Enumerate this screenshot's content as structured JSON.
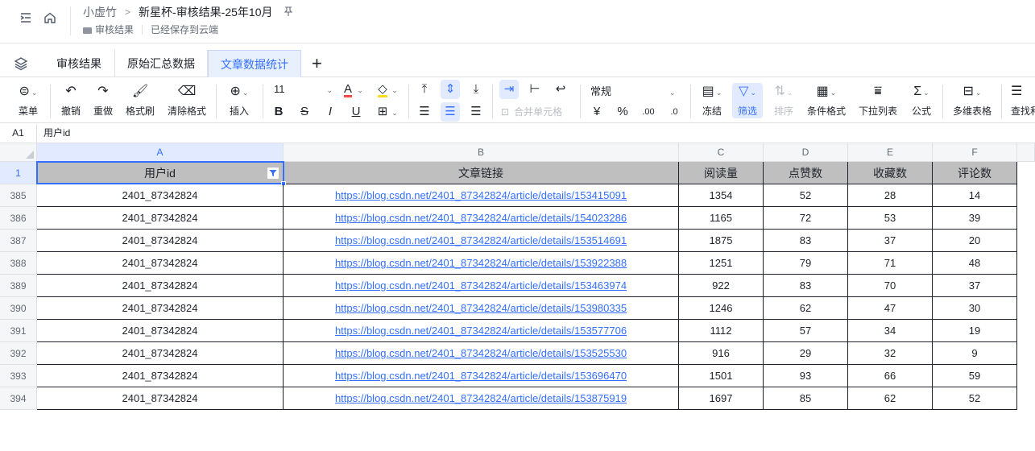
{
  "header": {
    "breadcrumb_parent": "小虚竹",
    "doc_title": "新星杯-审核结果-25年10月",
    "folder": "审核结果",
    "save_status": "已经保存到云端"
  },
  "tabs": [
    "审核结果",
    "原始汇总数据",
    "文章数据统计"
  ],
  "toolbar": {
    "menu": "菜单",
    "undo": "撤销",
    "redo": "重做",
    "format_painter": "格式刷",
    "clear_format": "清除格式",
    "insert": "插入",
    "font_size": "11",
    "merge_cells": "合并单元格",
    "number_format": "常规",
    "currency": "¥",
    "percent": "%",
    "freeze": "冻结",
    "filter": "筛选",
    "sort": "排序",
    "conditional_format": "条件格式",
    "dropdown_list": "下拉列表",
    "formula": "公式",
    "pivot": "多维表格",
    "find": "查找和"
  },
  "formula_bar": {
    "cell_ref": "A1",
    "value": "用户id"
  },
  "grid": {
    "columns": [
      "A",
      "B",
      "C",
      "D",
      "E",
      "F"
    ],
    "header_row_num": "1",
    "headers": [
      "用户id",
      "文章链接",
      "阅读量",
      "点赞数",
      "收藏数",
      "评论数"
    ],
    "rows": [
      {
        "n": "385",
        "user": "2401_87342824",
        "link": "https://blog.csdn.net/2401_87342824/article/details/153415091",
        "read": "1354",
        "like": "52",
        "fav": "28",
        "comment": "14"
      },
      {
        "n": "386",
        "user": "2401_87342824",
        "link": "https://blog.csdn.net/2401_87342824/article/details/154023286",
        "read": "1165",
        "like": "72",
        "fav": "53",
        "comment": "39"
      },
      {
        "n": "387",
        "user": "2401_87342824",
        "link": "https://blog.csdn.net/2401_87342824/article/details/153514691",
        "read": "1875",
        "like": "83",
        "fav": "37",
        "comment": "20"
      },
      {
        "n": "388",
        "user": "2401_87342824",
        "link": "https://blog.csdn.net/2401_87342824/article/details/153922388",
        "read": "1251",
        "like": "79",
        "fav": "71",
        "comment": "48"
      },
      {
        "n": "389",
        "user": "2401_87342824",
        "link": "https://blog.csdn.net/2401_87342824/article/details/153463974",
        "read": "922",
        "like": "83",
        "fav": "70",
        "comment": "37"
      },
      {
        "n": "390",
        "user": "2401_87342824",
        "link": "https://blog.csdn.net/2401_87342824/article/details/153980335",
        "read": "1246",
        "like": "62",
        "fav": "47",
        "comment": "30"
      },
      {
        "n": "391",
        "user": "2401_87342824",
        "link": "https://blog.csdn.net/2401_87342824/article/details/153577706",
        "read": "1112",
        "like": "57",
        "fav": "34",
        "comment": "19"
      },
      {
        "n": "392",
        "user": "2401_87342824",
        "link": "https://blog.csdn.net/2401_87342824/article/details/153525530",
        "read": "916",
        "like": "29",
        "fav": "32",
        "comment": "9"
      },
      {
        "n": "393",
        "user": "2401_87342824",
        "link": "https://blog.csdn.net/2401_87342824/article/details/153696470",
        "read": "1501",
        "like": "93",
        "fav": "66",
        "comment": "59"
      },
      {
        "n": "394",
        "user": "2401_87342824",
        "link": "https://blog.csdn.net/2401_87342824/article/details/153875919",
        "read": "1697",
        "like": "85",
        "fav": "62",
        "comment": "52"
      }
    ]
  },
  "colors": {
    "accent": "#3370ff",
    "header_fill": "#bfbfbf"
  }
}
